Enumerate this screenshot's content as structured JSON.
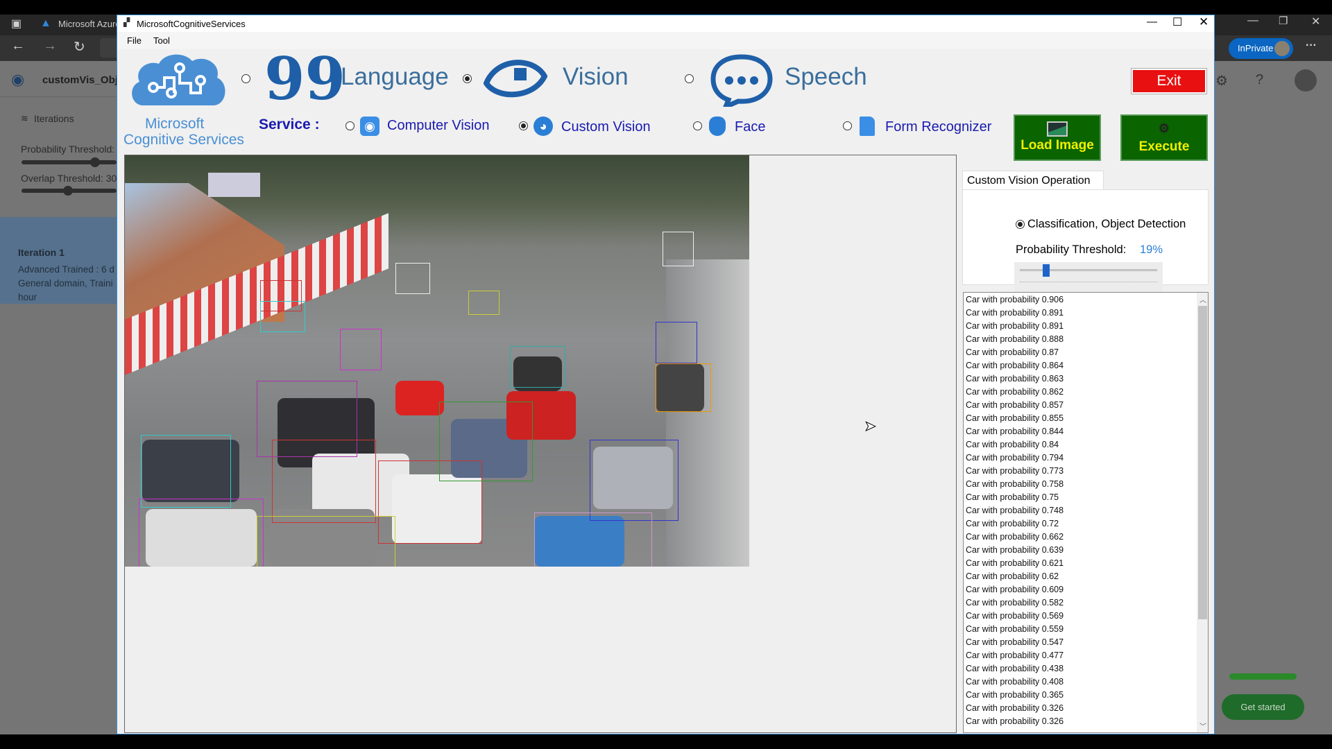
{
  "browser": {
    "tab_title": "Microsoft Azure",
    "project_name": "customVis_Objec",
    "iterations_label": "Iterations",
    "probability_threshold_label": "Probability Threshold:",
    "overlap_threshold_label": "Overlap Threshold: 30",
    "iteration": {
      "title": "Iteration 1",
      "line1": "Advanced Trained : 6 d",
      "line2": "General domain, Traini",
      "line3": "hour"
    },
    "inprivate_label": "InPrivate",
    "more_label": "···",
    "help_label": "?",
    "get_started_label": "Get started",
    "probability_slider_value": 0.6,
    "overlap_slider_value": 0.3
  },
  "app": {
    "title": "MicrosoftCognitiveServices",
    "menu": [
      "File",
      "Tool"
    ],
    "logo_line1": "Microsoft",
    "logo_line2": "Cognitive Services",
    "categories": [
      {
        "label": "Language",
        "selected": false,
        "icon": "quote-icon"
      },
      {
        "label": "Vision",
        "selected": true,
        "icon": "eye-icon"
      },
      {
        "label": "Speech",
        "selected": false,
        "icon": "speech-bubble-icon"
      }
    ],
    "exit_label": "Exit",
    "service_label": "Service :",
    "services": [
      {
        "label": "Computer Vision",
        "selected": false
      },
      {
        "label": "Custom Vision",
        "selected": true
      },
      {
        "label": "Face",
        "selected": false
      },
      {
        "label": "Form Recognizer",
        "selected": false
      }
    ],
    "load_image_label": "Load Image",
    "execute_label": "Execute",
    "operation_tab": "Custom Vision Operation",
    "operation_option": "Classification, Object Detection",
    "threshold_label": "Probability Threshold:",
    "threshold_value": "19%",
    "threshold_fraction": 0.19,
    "results": [
      "Car with probability 0.906",
      "Car with probability 0.891",
      "Car with probability 0.891",
      "Car with probability 0.888",
      "Car with probability 0.87",
      "Car with probability 0.864",
      "Car with probability 0.863",
      "Car with probability 0.862",
      "Car with probability 0.857",
      "Car with probability 0.855",
      "Car with probability 0.844",
      "Car with probability 0.84",
      "Car with probability 0.794",
      "Car with probability 0.773",
      "Car with probability 0.758",
      "Car with probability 0.75",
      "Car with probability 0.748",
      "Car with probability 0.72",
      "Car with probability 0.662",
      "Car with probability 0.639",
      "Car with probability 0.621",
      "Car with probability 0.62",
      "Car with probability 0.609",
      "Car with probability 0.582",
      "Car with probability 0.569",
      "Car with probability 0.559",
      "Car with probability 0.547",
      "Car with probability 0.477",
      "Car with probability 0.438",
      "Car with probability 0.408",
      "Car with probability 0.365",
      "Car with probability 0.326",
      "Car with probability 0.326"
    ],
    "colors": {
      "accent_blue": "#3a6e9c",
      "service_blue": "#1a1ab0",
      "exit_red": "#e81010",
      "button_green": "#0a6400",
      "button_text": "#f0f000"
    }
  }
}
